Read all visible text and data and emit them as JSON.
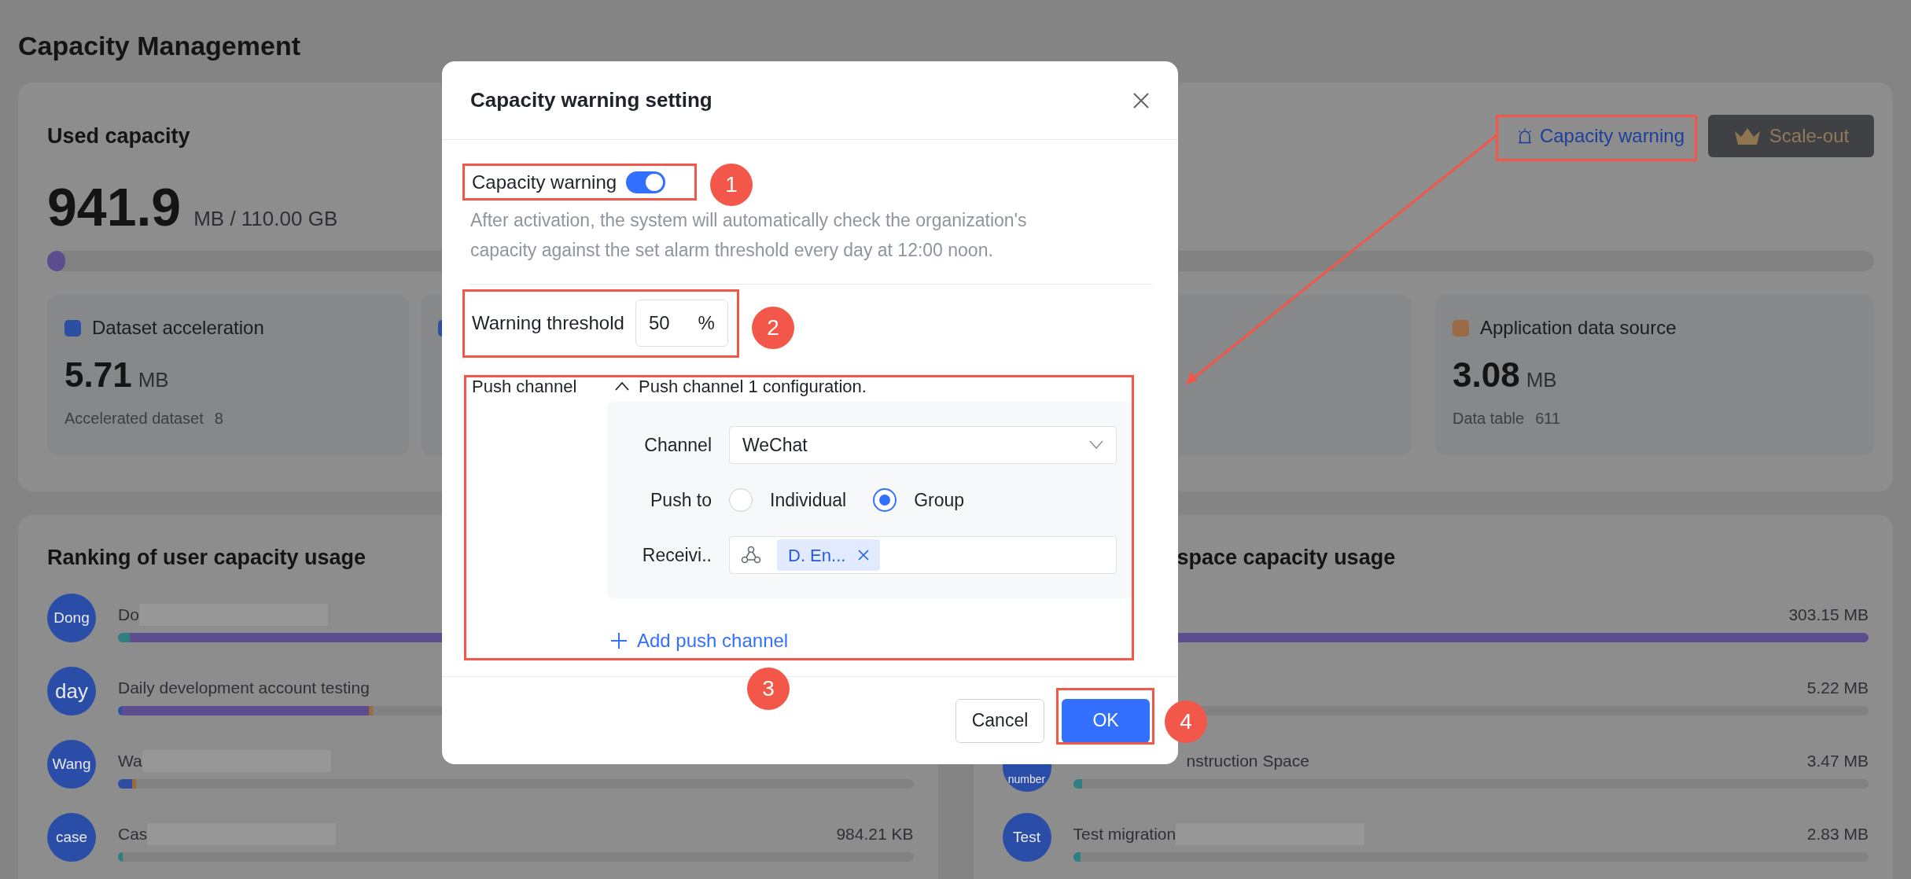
{
  "page": {
    "title": "Capacity Management"
  },
  "used_capacity": {
    "title": "Used capacity",
    "value": "941.9",
    "unit": "MB / 110.00 GB",
    "level": 0.01,
    "warning_link": "Capacity warning",
    "scale_out_button": "Scale-out"
  },
  "stat_cards": [
    {
      "kind": "full",
      "color": "#2d4fa3",
      "label": "Dataset acceleration",
      "value": "5.71",
      "unit": "MB",
      "meta_label": "Accelerated dataset",
      "meta_value": "8"
    },
    {
      "kind": "covered",
      "color": "#2d4fa3"
    },
    {
      "kind": "covered"
    },
    {
      "kind": "full",
      "color": "#9a6a45",
      "label": "Application data source",
      "value": "3.08",
      "unit": "MB",
      "meta_label": "Data table",
      "meta_value": "611"
    }
  ],
  "user_ranking": {
    "title": "Ranking of user capacity usage",
    "rows": [
      {
        "avatar": "Dong",
        "name": "Do",
        "redacted": true,
        "segments": [
          {
            "color": "#2f7f82",
            "level": 0.015
          },
          {
            "color": "#5c4d8f",
            "level": 0.985
          }
        ]
      },
      {
        "avatar": "day",
        "name": "Daily development account testing",
        "redacted": false,
        "segments": [
          {
            "color": "#2d4fa3",
            "level": 0.005
          },
          {
            "color": "#5c4d8f",
            "level": 0.31
          },
          {
            "color": "#9a6a3a",
            "level": 0.003
          }
        ]
      },
      {
        "avatar": "Wang",
        "name": "Wa",
        "redacted": true,
        "segments": [
          {
            "color": "#2d4fa3",
            "level": 0.018
          },
          {
            "color": "#9a6a3a",
            "level": 0.003
          }
        ]
      },
      {
        "avatar": "case",
        "name": "Cas",
        "redacted": true,
        "value": "984.21 KB",
        "segments": [
          {
            "color": "#2f7f82",
            "level": 0.006
          }
        ]
      }
    ]
  },
  "space_ranking": {
    "title": "space capacity usage",
    "rows": [
      {
        "value": "303.15 MB",
        "segments": [
          {
            "color": "#5c4d8f",
            "level": 1
          }
        ]
      },
      {
        "value": "5.22 MB"
      },
      {
        "avatar": "number",
        "name": "nstruction Space",
        "value": "3.47 MB",
        "segments": [
          {
            "color": "#2f7f82",
            "level": 0.011
          }
        ]
      },
      {
        "avatar": "Test",
        "name": "Test migration",
        "redacted": true,
        "value": "2.83 MB",
        "segments": [
          {
            "color": "#2f7f82",
            "level": 0.009
          }
        ]
      }
    ]
  },
  "dialog": {
    "title": "Capacity warning setting",
    "warning_toggle": {
      "label": "Capacity warning",
      "on": true
    },
    "description": "After activation, the system will automatically check the organization's capacity against the set alarm threshold every day at 12:00 noon.",
    "threshold": {
      "label": "Warning threshold",
      "value": "50",
      "suffix": "%"
    },
    "push_channel": {
      "label": "Push channel",
      "expanded": true,
      "group_title": "Push channel 1 configuration.",
      "channel": {
        "label": "Channel",
        "value": "WeChat"
      },
      "push_to": {
        "label": "Push to",
        "options": [
          {
            "label": "Individual",
            "selected": false
          },
          {
            "label": "Group",
            "selected": true
          }
        ]
      },
      "receiving": {
        "label": "Receivi..",
        "tags": [
          "D. En..."
        ]
      },
      "add_button": "Add push channel"
    },
    "cancel_button": "Cancel",
    "ok_button": "OK"
  },
  "annotations": {
    "callouts": [
      {
        "number": "1"
      },
      {
        "number": "2"
      },
      {
        "number": "3"
      },
      {
        "number": "4"
      }
    ]
  }
}
